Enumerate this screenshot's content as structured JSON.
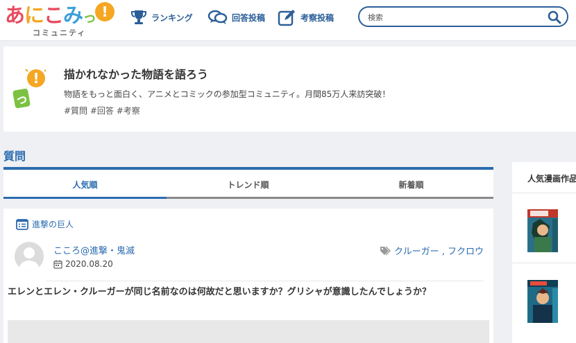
{
  "header": {
    "logo_main": "あにこみ",
    "logo_chars": [
      "あ",
      "に",
      "こ",
      "み",
      "っ"
    ],
    "logo_colors": [
      "#e84a5f",
      "#f5a623",
      "#e84a5f",
      "#3aa0d8",
      "#7cc242"
    ],
    "logo_bubble": "!",
    "logo_sub": "コミュニティ",
    "nav": [
      {
        "label": "ランキング",
        "icon": "trophy-icon"
      },
      {
        "label": "回答投稿",
        "icon": "speech-bubbles-icon"
      },
      {
        "label": "考察投稿",
        "icon": "edit-pencil-icon"
      }
    ],
    "search_placeholder": "検索",
    "search_icon": "search-icon"
  },
  "hero": {
    "title": "描かれなかった物語を語ろう",
    "description": "物語をもっと面白く、アニメとコミックの参加型コミュニティ。月間85万人来訪突破！",
    "tags": "#質問 #回答 #考察",
    "icon_text": "っ",
    "icon_bubble": "!"
  },
  "section": {
    "title": "質問",
    "tabs": [
      "人気順",
      "トレンド順",
      "新着順"
    ],
    "active_tab_index": 0
  },
  "card": {
    "category": "進撃の巨人",
    "user_name": "こころ@進撃・鬼滅",
    "date": "2020.08.20",
    "tags": "クルーガー , フクロウ",
    "question": "エレンとエレン・クルーガーが同じ名前なのは何故だと思いますか？グリシャが意識したんでしょうか？"
  },
  "sidebar": {
    "title": "人気漫画作品"
  },
  "colors": {
    "accent": "#2b6cb0",
    "nav": "#2b5f98",
    "background": "#eef0f3"
  }
}
